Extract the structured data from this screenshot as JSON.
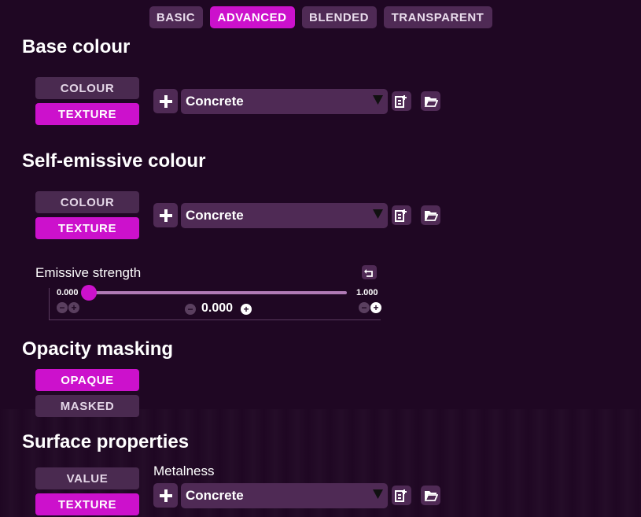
{
  "tabs": [
    {
      "label": "BASIC",
      "active": false
    },
    {
      "label": "ADVANCED",
      "active": true
    },
    {
      "label": "BLENDED",
      "active": false
    },
    {
      "label": "TRANSPARENT",
      "active": false
    }
  ],
  "base_colour": {
    "heading": "Base colour",
    "mode_colour": "COLOUR",
    "mode_texture": "TEXTURE",
    "selected_mode": "TEXTURE",
    "texture_value": "Concrete"
  },
  "self_emissive": {
    "heading": "Self-emissive colour",
    "mode_colour": "COLOUR",
    "mode_texture": "TEXTURE",
    "selected_mode": "TEXTURE",
    "texture_value": "Concrete",
    "strength_label": "Emissive strength",
    "strength_min": "0.000",
    "strength_max": "1.000",
    "strength_value": "0.000"
  },
  "opacity_masking": {
    "heading": "Opacity masking",
    "option_opaque": "OPAQUE",
    "option_masked": "MASKED",
    "selected": "OPAQUE"
  },
  "surface_properties": {
    "heading": "Surface properties",
    "mode_value": "VALUE",
    "mode_texture": "TEXTURE",
    "selected_mode": "TEXTURE",
    "metalness_label": "Metalness",
    "texture_value": "Concrete"
  },
  "colors": {
    "accent": "#cc11cc",
    "button": "#4f2a55",
    "background": "#1f0723"
  },
  "icons": [
    "plus-icon",
    "dropdown-arrow-icon",
    "copy-texture-icon",
    "folder-open-icon",
    "reset-icon",
    "minus-icon"
  ]
}
